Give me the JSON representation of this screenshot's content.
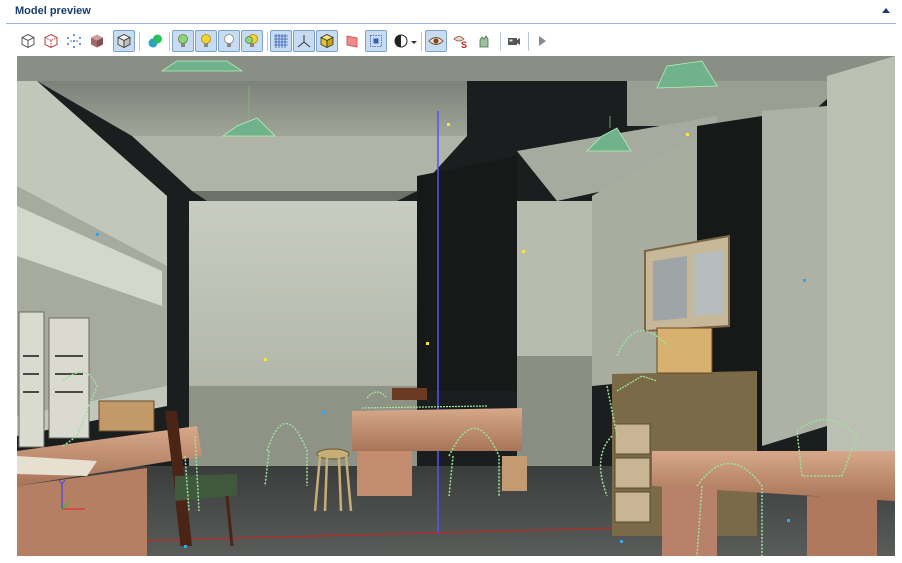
{
  "panel": {
    "title": "Model preview"
  },
  "toolbar": {
    "buttons": [
      {
        "name": "view-wireframe-button",
        "icon": "cube-outline-icon",
        "active": false
      },
      {
        "name": "view-hidden-line-button",
        "icon": "cube-dashed-icon",
        "active": false
      },
      {
        "name": "view-points-button",
        "icon": "point-cloud-icon",
        "active": false
      },
      {
        "name": "view-solid-button",
        "icon": "cube-solid-icon",
        "active": false
      },
      {
        "name": "view-textured-button",
        "icon": "cube-textured-icon",
        "active": true
      },
      {
        "name": "view-materials-button",
        "icon": "material-spheres-icon",
        "active": false
      },
      {
        "name": "light-ambient-button",
        "icon": "bulb-green-icon",
        "active": true
      },
      {
        "name": "light-directional-button",
        "icon": "bulb-yellow-icon",
        "active": true
      },
      {
        "name": "light-point-button",
        "icon": "bulb-white-icon",
        "active": true
      },
      {
        "name": "light-all-button",
        "icon": "bulb-multi-icon",
        "active": true
      },
      {
        "name": "show-grid-button",
        "icon": "grid-icon",
        "active": true
      },
      {
        "name": "show-axes-button",
        "icon": "axes-icon",
        "active": true
      },
      {
        "name": "show-bounds-button",
        "icon": "bounding-box-icon",
        "active": true
      },
      {
        "name": "show-normals-button",
        "icon": "red-plane-icon",
        "active": false
      },
      {
        "name": "show-selection-button",
        "icon": "selection-box-icon",
        "active": true
      },
      {
        "name": "shading-mode-button",
        "icon": "contrast-dropdown-icon",
        "active": false
      },
      {
        "name": "view-eye-button",
        "icon": "eye-icon",
        "active": true
      },
      {
        "name": "show-sockets-button",
        "icon": "socket-icon",
        "active": false
      },
      {
        "name": "show-hands-button",
        "icon": "hand-icon",
        "active": false
      },
      {
        "name": "camera-button",
        "icon": "camera-icon",
        "active": false
      },
      {
        "name": "play-animation-button",
        "icon": "play-icon",
        "active": false
      }
    ]
  },
  "viewport": {
    "name": "3d-scene-viewport"
  },
  "colors": {
    "header_text": "#1a3d6e",
    "active_bg": "#c7dcf0",
    "active_border": "#7ea2c7"
  }
}
